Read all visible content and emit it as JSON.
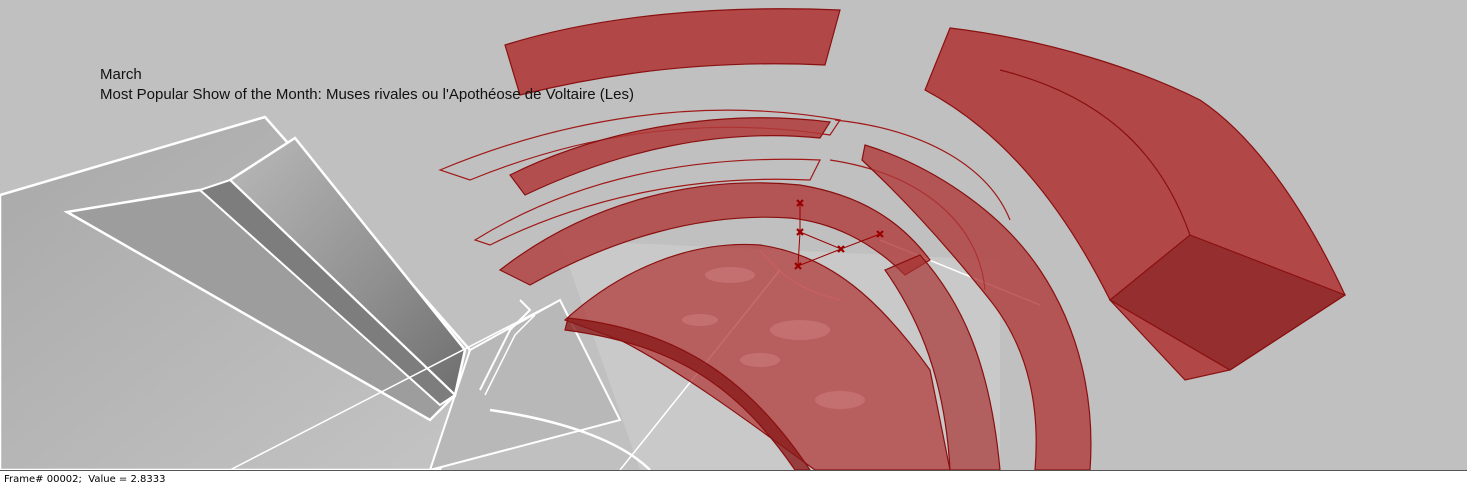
{
  "viewport": {
    "month_label": "March",
    "show_label": "Most Popular Show of the Month: Muses rivales ou l'Apothéose de Voltaire (Les)"
  },
  "status_bar": {
    "frame": "Frame# 00002;",
    "value": "Value = 2.8333"
  },
  "colors": {
    "background": "#c0c0c0",
    "seating_fill": "#b03a3a",
    "seating_edge": "#8a1010",
    "building_edge": "#ffffff",
    "marker": "#9a0000"
  },
  "icons": {
    "markers": "x-marker-icon"
  }
}
